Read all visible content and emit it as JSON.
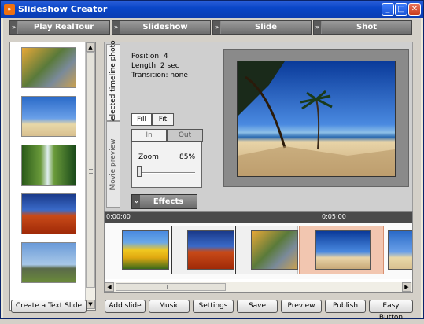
{
  "window": {
    "title": "Slideshow Creator",
    "app_icon": "»",
    "buttons": {
      "minimize": "_",
      "maximize": "□",
      "close": "✕"
    }
  },
  "menubar": {
    "chevron": "»",
    "items": [
      {
        "label": "Play RealTour"
      },
      {
        "label": "Slideshow"
      },
      {
        "label": "Slide"
      },
      {
        "label": "Shot"
      }
    ]
  },
  "side_tabs": {
    "selected_timeline_photo": "Selected timeline photo",
    "movie_preview": "Movie preview"
  },
  "photo_info": {
    "position": "Position: 4",
    "length": "Length: 2 sec",
    "transition": "Transition: none"
  },
  "fit_controls": {
    "fill": "Fill",
    "fit": "Fit"
  },
  "zoom_controls": {
    "tab_in": "In",
    "tab_out": "Out",
    "zoom_label": "Zoom:",
    "zoom_value": "85%",
    "zoom_level": 0.85
  },
  "effects_button": {
    "label": "Effects"
  },
  "timeline": {
    "times": [
      "0:00:00",
      "0:05:00"
    ]
  },
  "scroll_arrows": {
    "up": "▲",
    "down": "▼",
    "left": "◀",
    "right": "▶"
  },
  "bottom_buttons": {
    "create_text_slide": "Create a Text Slide",
    "add_slide": "Add slide",
    "music": "Music",
    "settings": "Settings",
    "save": "Save",
    "preview": "Preview",
    "publish": "Publish",
    "easy_button": "Easy Button"
  },
  "colors": {
    "titlebar": "#0a46c8",
    "selected_clip": "#f2c6b0",
    "menubar": "#7a7a7a"
  }
}
